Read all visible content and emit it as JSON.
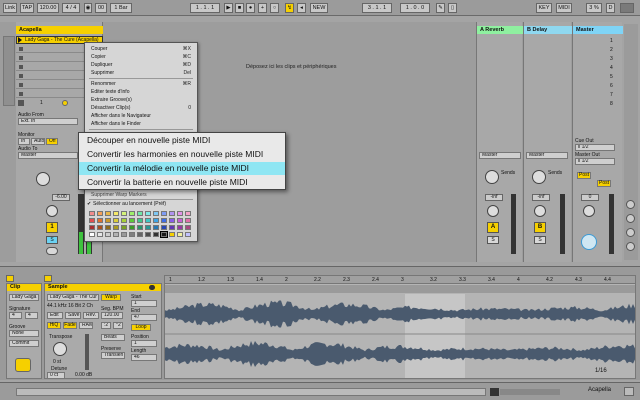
{
  "transport": {
    "link": "Link",
    "tap": "TAP",
    "tempo": "120.00",
    "time_sig": "4 / 4",
    "metronome": "00",
    "quantize": "1 Bar",
    "position": "1 . 1 . 1",
    "view_label": "NEW",
    "loop_start": "3 . 1 . 1",
    "loop_length": "1 . 0 . 0",
    "key_label": "KEY",
    "midi_label": "MIDI",
    "cpu": "3 %",
    "d_label": "D"
  },
  "tracks": {
    "acapella": {
      "title": "Acapella",
      "clip_name": "Lady Gaga - The Cure (Acapella)"
    },
    "return_a": {
      "title": "A Reverb"
    },
    "return_b": {
      "title": "B Delay"
    },
    "master": {
      "title": "Master"
    },
    "drop_zone": "Déposez ici les clips et périphériques",
    "scene_numbers": [
      "1",
      "2",
      "3",
      "4",
      "5",
      "6",
      "7",
      "8"
    ]
  },
  "mixer": {
    "audio_from": "Audio From",
    "audio_from_val": "Ext. In",
    "monitor": "Monitor",
    "monitor_in": "In",
    "monitor_auto": "Auto",
    "monitor_off": "Off",
    "audio_to": "Audio To",
    "audio_to_val": "Master",
    "cue_out": "Cue Out",
    "cue_out_val": "ii 1/2",
    "master_out": "Master Out",
    "master_out_val": "ii 1/2",
    "sends": "Sends",
    "post": "Post",
    "vol_acapella": "-6.00",
    "vol_a": "-inf",
    "vol_b": "-inf",
    "vol_master": "0",
    "track_num_1": "1",
    "track_a": "A",
    "track_b": "B",
    "track_s": "S"
  },
  "context_menu": {
    "items": [
      {
        "label": "Couper",
        "shortcut": "⌘X"
      },
      {
        "label": "Copier",
        "shortcut": "⌘C"
      },
      {
        "label": "Dupliquer",
        "shortcut": "⌘D"
      },
      {
        "label": "Supprimer",
        "shortcut": "Del"
      },
      {
        "label": "Renommer",
        "shortcut": "⌘R"
      },
      {
        "label": "Editer texte d'info",
        "shortcut": ""
      },
      {
        "label": "Extraire Groove(s)",
        "shortcut": ""
      },
      {
        "label": "Désactiver Clip(s)",
        "shortcut": "0"
      },
      {
        "label": "Afficher dans le Navigateur",
        "shortcut": ""
      },
      {
        "label": "Afficher dans le Finder",
        "shortcut": ""
      }
    ],
    "partial_item": "Supprimer Warp Markers",
    "checked_item": "Sélectionner au lancement (Préf)",
    "swatch_colors": [
      "#f28c8c",
      "#f5a05a",
      "#e8b64a",
      "#f6e96a",
      "#d4f27a",
      "#9ef06a",
      "#6fe7a8",
      "#7ee8e6",
      "#7fc8f4",
      "#7f9cf4",
      "#b093f0",
      "#e293e8",
      "#f3a3c8",
      "#e05050",
      "#e0702c",
      "#c99a2a",
      "#d9cc3a",
      "#a8d03a",
      "#5cc83a",
      "#3ec58a",
      "#3ec6c4",
      "#3ea4e6",
      "#3e6ee6",
      "#8a5ee6",
      "#c85ed4",
      "#e06ea8",
      "#a83030",
      "#a8501e",
      "#8c6a1c",
      "#a89a20",
      "#78a028",
      "#3a9a28",
      "#28946a",
      "#289694",
      "#2878b4",
      "#2848b4",
      "#6438b4",
      "#9838a4",
      "#a84880",
      "#ffffff",
      "#e6e6e6",
      "#cccccc",
      "#b3b3b3",
      "#999999",
      "#808080",
      "#666666",
      "#4d4d4d",
      "#333333",
      "#1a1a1a",
      "#f6d000",
      "#f0f0a0",
      "#c0c0ff"
    ]
  },
  "submenu": {
    "items": [
      {
        "label": "Découper en nouvelle piste MIDI",
        "highlighted": false
      },
      {
        "label": "Convertir les harmonies en nouvelle piste MIDI",
        "highlighted": false
      },
      {
        "label": "Convertir la mélodie en nouvelle piste MIDI",
        "highlighted": true
      },
      {
        "label": "Convertir la batterie en nouvelle piste MIDI",
        "highlighted": false
      }
    ]
  },
  "clip_view": {
    "clip_title": "Clip",
    "clip_name": "Lady Gaga",
    "signature_label": "Signature",
    "sig_num": "4",
    "sig_den": "4",
    "groove_label": "Groove",
    "groove_val": "None",
    "commit": "Commit",
    "sample_title": "Sample",
    "sample_name": "Lady Gaga - The Cur",
    "sample_info": "44.1 kHz 16 Bit 2 Ch",
    "edit": "Edit",
    "save": "Save",
    "rev": "Rev.",
    "hiq": "HiQ",
    "fade": "Fade",
    "ram": "RAM",
    "transpose_label": "Transpose",
    "transpose_val": "0 st",
    "detune_label": "Detune",
    "detune_val": "0 ct",
    "gain_val": "0.00 dB",
    "warp": "Warp",
    "seg_bpm_label": "Seg. BPM",
    "seg_bpm_val": "120.00",
    "beats_mode": "Beats",
    "preserve_label": "Preserve",
    "preserve_val": "Transien",
    "start_label": "Start",
    "start_val": "1",
    "end_label": "End",
    "end_val": "47",
    "loop": "Loop",
    "position_label": "Position",
    "position_val": "1",
    "length_label": "Length",
    "length_val": "46",
    "ruler": [
      "1",
      "1.2",
      "1.3",
      "1.4",
      "2",
      "2.2",
      "2.3",
      "2.4",
      "3",
      "3.2",
      "3.3",
      "3.4",
      "4",
      "4.2",
      "4.3",
      "4.4"
    ],
    "page_indicator": "1/16"
  },
  "status": {
    "track_name": "Acapella"
  }
}
